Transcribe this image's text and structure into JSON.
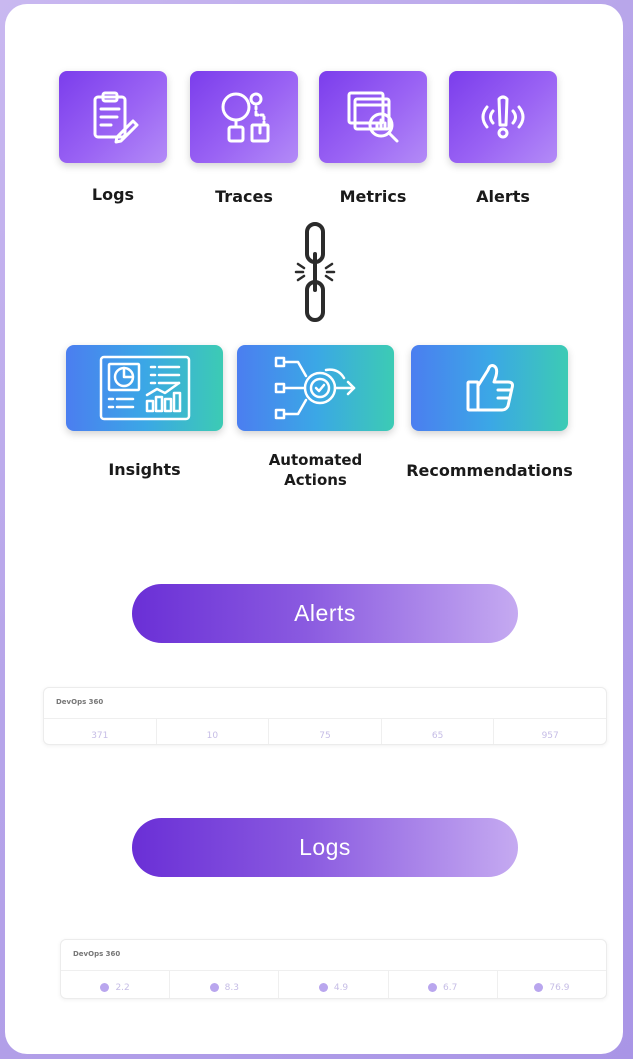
{
  "sources": [
    {
      "label": "Logs",
      "icon": "clipboard-edit-icon"
    },
    {
      "label": "Traces",
      "icon": "magnifier-trace-icon"
    },
    {
      "label": "Metrics",
      "icon": "chart-magnifier-icon"
    },
    {
      "label": "Alerts",
      "icon": "alarm-exclamation-icon"
    }
  ],
  "connector": {
    "icon": "broken-chain-link-icon"
  },
  "outcomes": [
    {
      "label": "Insights",
      "icon": "dashboard-insights-icon"
    },
    {
      "label_line1": "Automated",
      "label_line2": "Actions",
      "icon": "automation-flow-icon"
    },
    {
      "label": "Recommendations",
      "icon": "thumbs-up-icon"
    }
  ],
  "sections": {
    "alerts": {
      "button_label": "Alerts",
      "preview_title": "DevOps 360",
      "preview_values": [
        "371",
        "10",
        "75",
        "65",
        "957"
      ]
    },
    "logs": {
      "button_label": "Logs",
      "preview_title": "DevOps 360",
      "preview_values": [
        "2.2",
        "8.3",
        "4.9",
        "6.7",
        "76.9"
      ]
    }
  },
  "colors": {
    "source_tile": "#8b52f0",
    "outcome_tile_start": "#4b7ef0",
    "outcome_tile_end": "#3ccbb4",
    "pill_start": "#6a2fd6",
    "pill_end": "#c5aaf1",
    "page_background": "#b7a5ea"
  }
}
